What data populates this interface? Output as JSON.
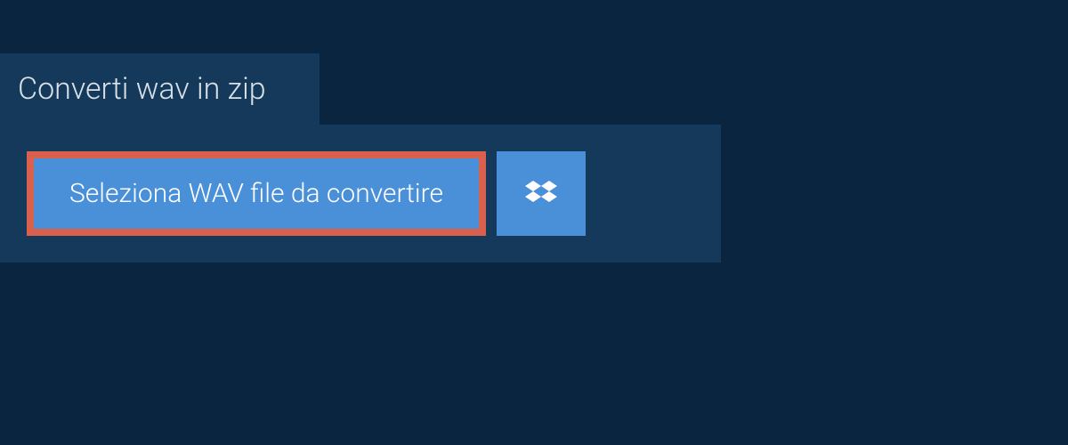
{
  "tab": {
    "title": "Converti wav in zip"
  },
  "buttons": {
    "select_file_label": "Seleziona WAV file da convertire"
  }
}
